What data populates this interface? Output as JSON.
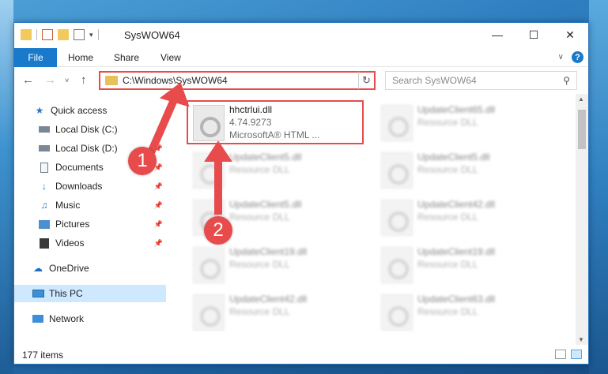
{
  "window": {
    "title": "SysWOW64"
  },
  "ribbon": {
    "tabs": [
      "File",
      "Home",
      "Share",
      "View"
    ]
  },
  "address": {
    "path": "C:\\Windows\\SysWOW64"
  },
  "search": {
    "placeholder": "Search SysWOW64"
  },
  "sidebar": {
    "items": [
      {
        "label": "Quick access",
        "icon": "star-icon"
      },
      {
        "label": "Local Disk (C:)",
        "icon": "drive-icon"
      },
      {
        "label": "Local Disk (D:)",
        "icon": "drive-icon"
      },
      {
        "label": "Documents",
        "icon": "documents-icon"
      },
      {
        "label": "Downloads",
        "icon": "download-icon"
      },
      {
        "label": "Music",
        "icon": "music-icon"
      },
      {
        "label": "Pictures",
        "icon": "pictures-icon"
      },
      {
        "label": "Videos",
        "icon": "videos-icon"
      },
      {
        "label": "OneDrive",
        "icon": "cloud-icon"
      },
      {
        "label": "This PC",
        "icon": "computer-icon"
      },
      {
        "label": "Network",
        "icon": "network-icon"
      }
    ]
  },
  "files": {
    "highlighted": {
      "name": "hhctrlui.dll",
      "version": "4.74.9273",
      "company": "MicrosoftA® HTML ..."
    },
    "left": [
      {
        "name": "UpdateClient5.dll",
        "type": "Resource DLL"
      },
      {
        "name": "UpdateClient5.dll",
        "type": "Resource DLL"
      },
      {
        "name": "UpdateClient19.dll",
        "type": "Resource DLL"
      },
      {
        "name": "UpdateClient42.dll",
        "type": "Resource DLL"
      }
    ],
    "right": [
      {
        "name": "UpdateClient65.dll",
        "type": "Resource DLL"
      },
      {
        "name": "UpdateClient5.dll",
        "type": "Resource DLL"
      },
      {
        "name": "UpdateClient42.dll",
        "type": "Resource DLL"
      },
      {
        "name": "UpdateClient19.dll",
        "type": "Resource DLL"
      },
      {
        "name": "UpdateClient63.dll",
        "type": "Resource DLL"
      }
    ]
  },
  "status": {
    "count": "177 items"
  },
  "annotations": {
    "badge1": "1",
    "badge2": "2",
    "accent": "#e84b4b"
  }
}
